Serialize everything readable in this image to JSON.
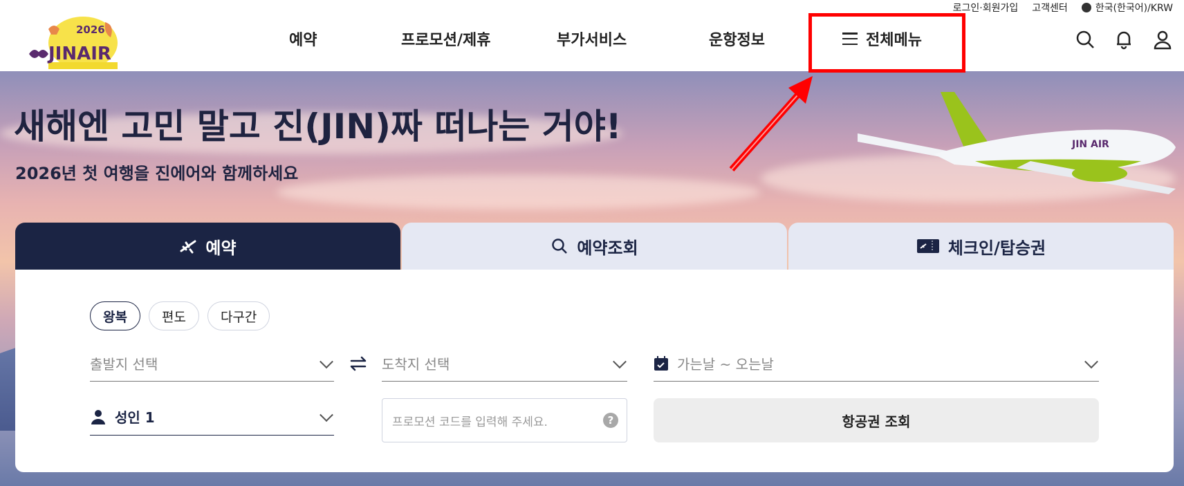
{
  "util": {
    "login": "로그인·회원가입",
    "support": "고객센터",
    "language": "한국(한국어)/KRW"
  },
  "logo": {
    "year": "2026",
    "brand": "JINAIR"
  },
  "nav": {
    "items": [
      "예약",
      "프로모션/제휴",
      "부가서비스",
      "운항정보"
    ],
    "full_menu": "전체메뉴"
  },
  "hero": {
    "title": "새해엔 고민 말고 진(JIN)짜 떠나는 거야!",
    "subtitle": "2026년 첫 여행을 진에어와 함께하세요",
    "plane_livery": "JIN AIR"
  },
  "tabs": [
    {
      "label": "예약",
      "icon": "airplane-icon",
      "active": true
    },
    {
      "label": "예약조회",
      "icon": "search-icon",
      "active": false
    },
    {
      "label": "체크인/탑승권",
      "icon": "boarding-pass-icon",
      "active": false
    }
  ],
  "booking": {
    "trip_types": [
      "왕복",
      "편도",
      "다구간"
    ],
    "selected_trip": "왕복",
    "departure_placeholder": "출발지 선택",
    "arrival_placeholder": "도착지 선택",
    "dates_placeholder": "가는날 ~ 오는날",
    "passengers": "성인 1",
    "promo_placeholder": "프로모션 코드를 입력해 주세요.",
    "promo_help": "?",
    "search_button": "항공권 조회"
  },
  "colors": {
    "primary": "#1b2444",
    "highlight": "#ff0000",
    "brand_green": "#9ac31c"
  }
}
